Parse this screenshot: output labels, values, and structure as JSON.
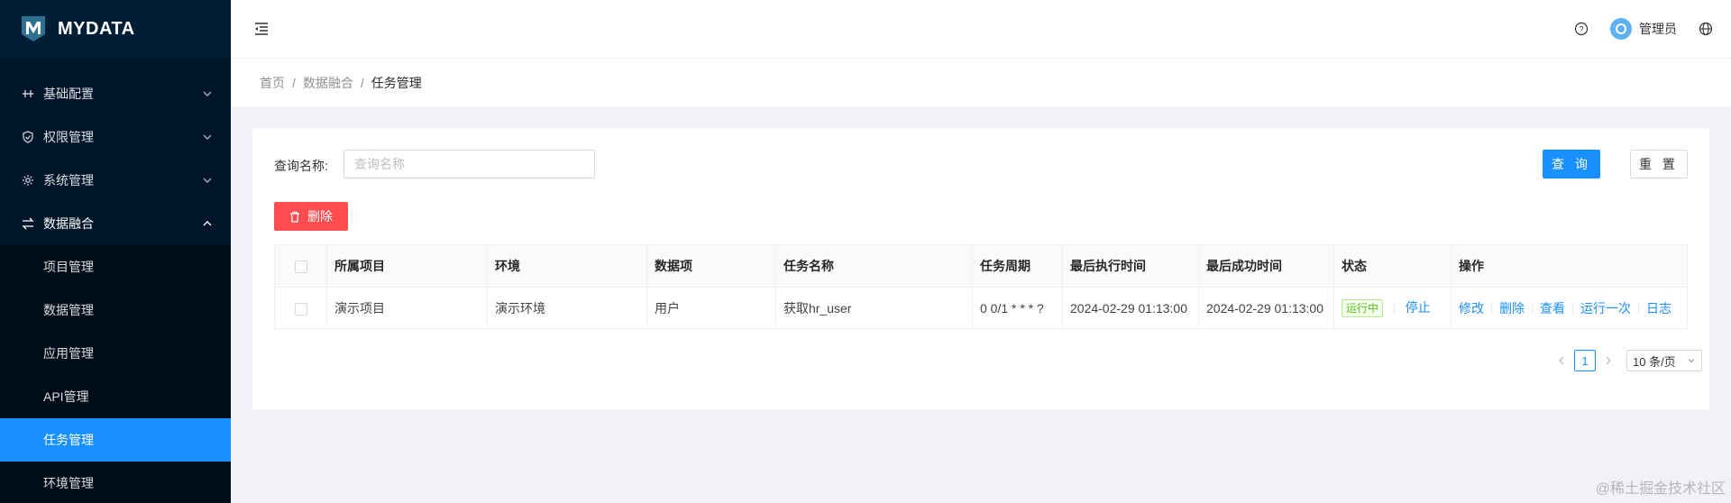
{
  "app": {
    "logo_text": "MYDATA"
  },
  "sidebar": {
    "groups": [
      {
        "label": "基础配置"
      },
      {
        "label": "权限管理"
      },
      {
        "label": "系统管理"
      },
      {
        "label": "数据融合"
      }
    ],
    "sub_items": [
      {
        "label": "项目管理"
      },
      {
        "label": "数据管理"
      },
      {
        "label": "应用管理"
      },
      {
        "label": "API管理"
      },
      {
        "label": "任务管理"
      },
      {
        "label": "环境管理"
      }
    ]
  },
  "header": {
    "user_name": "管理员"
  },
  "breadcrumb": {
    "items": [
      "首页",
      "数据融合",
      "任务管理"
    ],
    "separator": "/"
  },
  "search": {
    "label": "查询名称:",
    "placeholder": "查询名称",
    "query_button": "查 询",
    "reset_button": "重 置",
    "delete_button": "删除"
  },
  "table": {
    "columns": [
      "所属项目",
      "环境",
      "数据项",
      "任务名称",
      "任务周期",
      "最后执行时间",
      "最后成功时间",
      "状态",
      "操作"
    ],
    "rows": [
      {
        "project": "演示项目",
        "env": "演示环境",
        "data_item": "用户",
        "task_name": "获取hr_user",
        "cycle": "0 0/1 * * * ?",
        "last_exec": "2024-02-29 01:13:00",
        "last_success": "2024-02-29 01:13:00",
        "status": "运行中",
        "status_action": "停止",
        "actions": [
          "修改",
          "删除",
          "查看",
          "运行一次",
          "日志"
        ]
      }
    ]
  },
  "pagination": {
    "current": "1",
    "page_size": "10 条/页"
  },
  "watermark": "@稀土掘金技术社区",
  "colors": {
    "primary": "#1890ff",
    "danger": "#ff4d4f",
    "sidebar_bg": "#001529",
    "success": "#52c41a"
  }
}
